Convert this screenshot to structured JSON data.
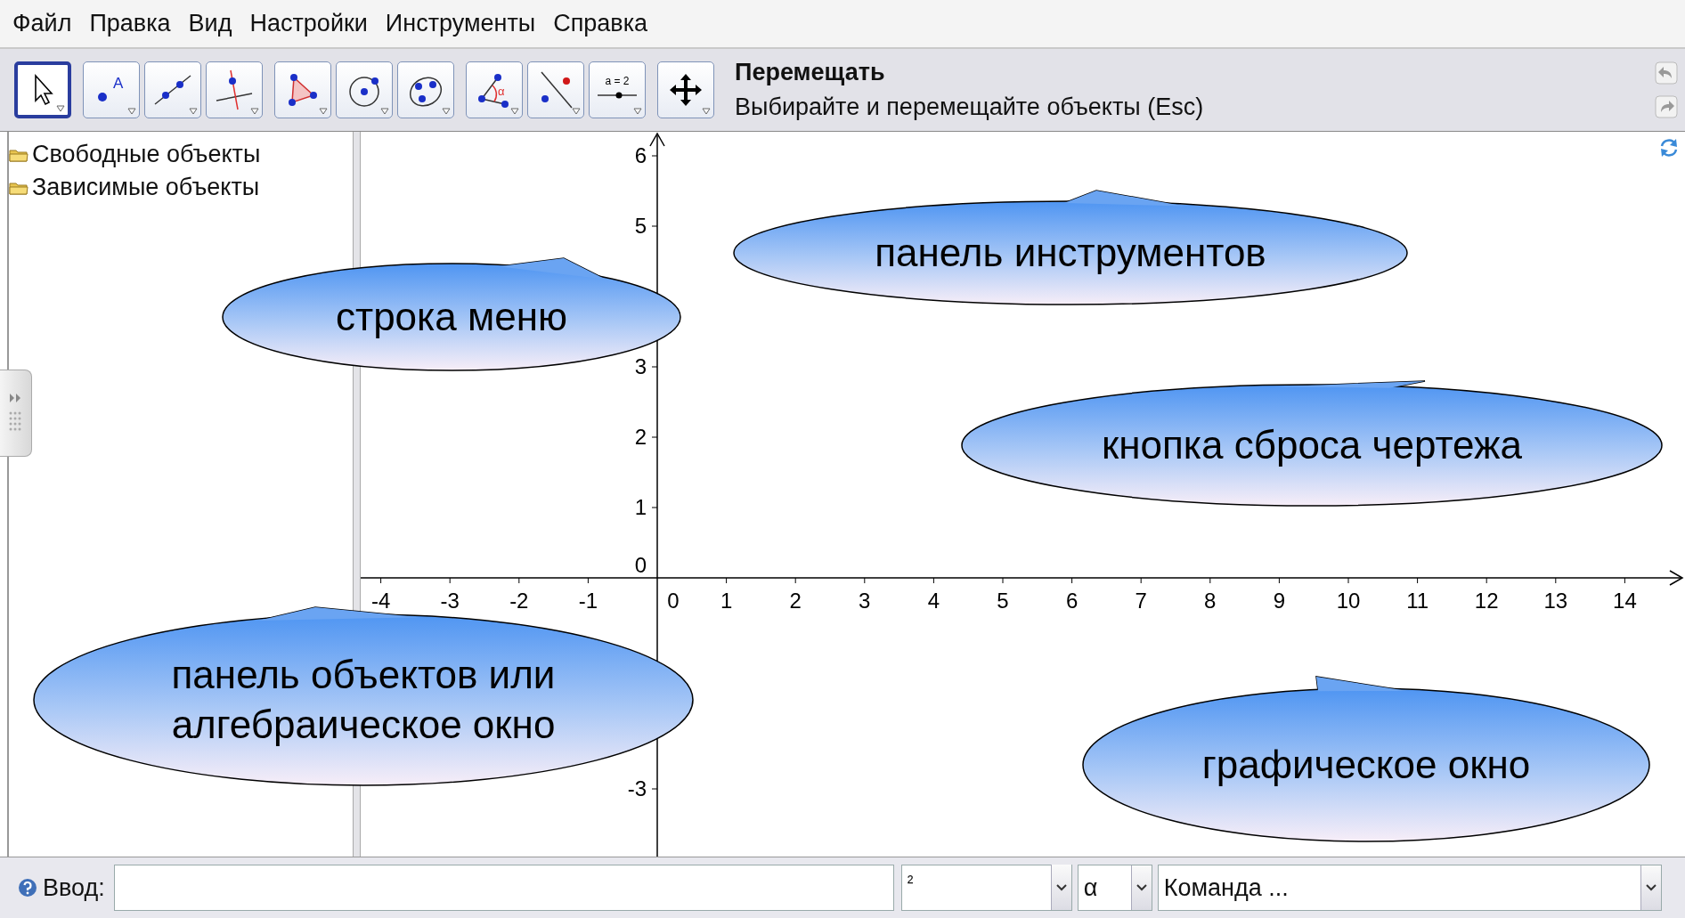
{
  "menu": [
    "Файл",
    "Правка",
    "Вид",
    "Настройки",
    "Инструменты",
    "Справка"
  ],
  "toolbar": {
    "groups": [
      [
        {
          "kind": "move",
          "selected": true
        }
      ],
      [
        {
          "kind": "point",
          "selected": false,
          "label": "A"
        },
        {
          "kind": "line",
          "selected": false
        },
        {
          "kind": "perpendicular",
          "selected": false
        }
      ],
      [
        {
          "kind": "polygon",
          "selected": false
        },
        {
          "kind": "circle",
          "selected": false
        },
        {
          "kind": "conic",
          "selected": false
        }
      ],
      [
        {
          "kind": "angle",
          "selected": false,
          "label": "α"
        },
        {
          "kind": "reflect",
          "selected": false
        },
        {
          "kind": "slider",
          "selected": false,
          "label": "a = 2"
        }
      ],
      [
        {
          "kind": "move-view",
          "selected": false
        }
      ]
    ],
    "tool_title": "Перемещать",
    "tool_description": "Выбирайте и перемещайте объекты (Esc)"
  },
  "algebra": {
    "items": [
      "Свободные объекты",
      "Зависимые объекты"
    ]
  },
  "graphics": {
    "x_labels": [
      "-4",
      "-3",
      "-2",
      "-1",
      "0",
      "1",
      "2",
      "3",
      "4",
      "5",
      "6",
      "7",
      "8",
      "9",
      "10",
      "11",
      "12",
      "13",
      "14"
    ],
    "y_labels": [
      "6",
      "5",
      "3",
      "2",
      "1",
      "0",
      "-3"
    ]
  },
  "callouts": [
    {
      "lines": [
        "панель инструментов"
      ]
    },
    {
      "lines": [
        "строка меню"
      ]
    },
    {
      "lines": [
        "кнопка сброса чертежа"
      ]
    },
    {
      "lines": [
        "панель объектов или",
        "алгебраическое окно"
      ]
    },
    {
      "lines": [
        "графическое окно"
      ]
    }
  ],
  "input_bar": {
    "label": "Ввод:",
    "symbols_value": "²",
    "greek_value": "α",
    "command_placeholder": "Команда ..."
  }
}
